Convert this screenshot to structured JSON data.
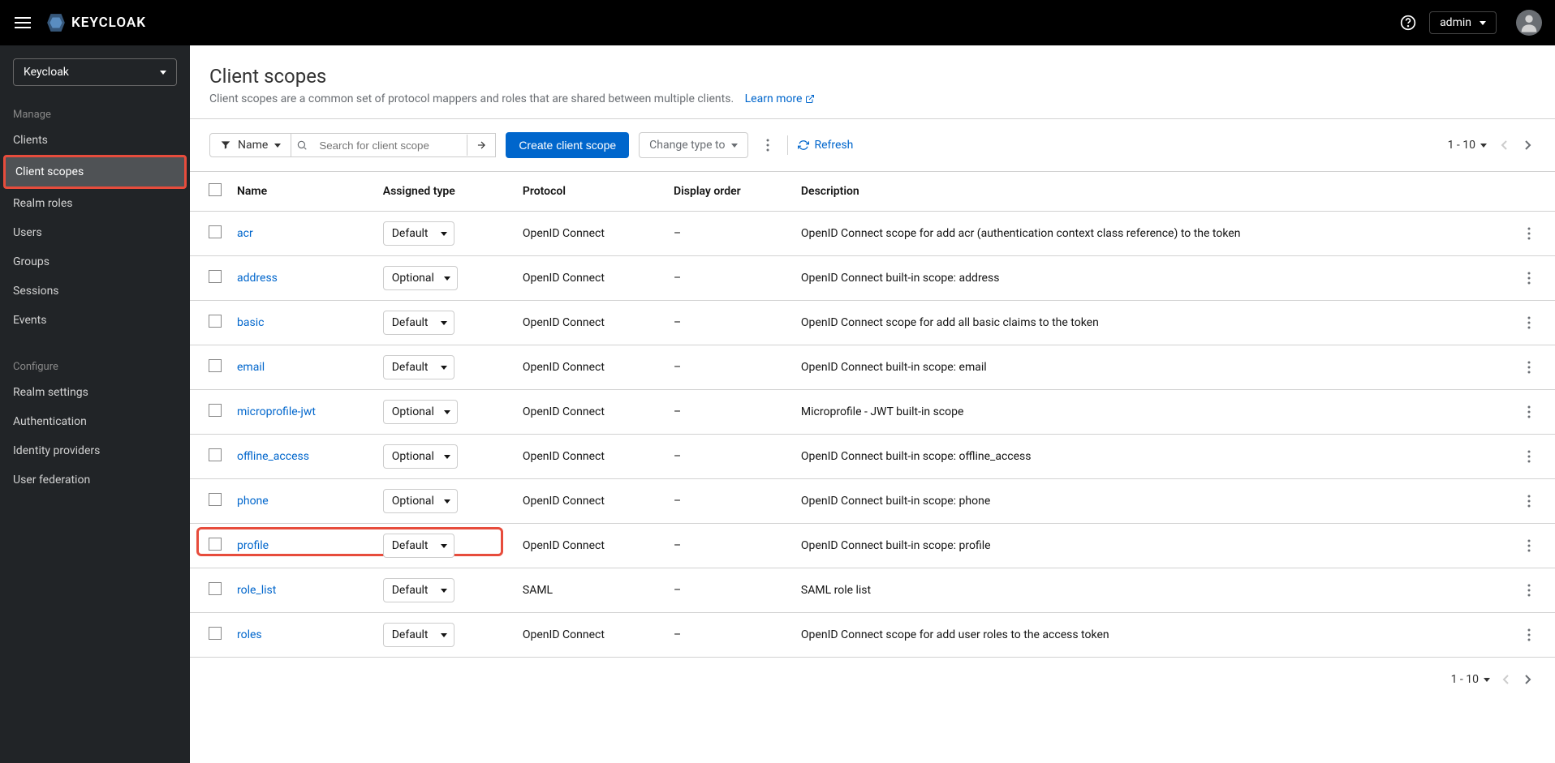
{
  "header": {
    "logo_text": "KEYCLOAK",
    "username": "admin"
  },
  "sidebar": {
    "realm_selected": "Keycloak",
    "section_manage": "Manage",
    "section_configure": "Configure",
    "items_manage": [
      {
        "label": "Clients"
      },
      {
        "label": "Client scopes"
      },
      {
        "label": "Realm roles"
      },
      {
        "label": "Users"
      },
      {
        "label": "Groups"
      },
      {
        "label": "Sessions"
      },
      {
        "label": "Events"
      }
    ],
    "items_configure": [
      {
        "label": "Realm settings"
      },
      {
        "label": "Authentication"
      },
      {
        "label": "Identity providers"
      },
      {
        "label": "User federation"
      }
    ]
  },
  "page": {
    "title": "Client scopes",
    "description": "Client scopes are a common set of protocol mappers and roles that are shared between multiple clients.",
    "learn_more": "Learn more"
  },
  "toolbar": {
    "filter_label": "Name",
    "search_placeholder": "Search for client scope",
    "create_button": "Create client scope",
    "change_type": "Change type to",
    "refresh": "Refresh",
    "page_info": "1 - 10"
  },
  "table": {
    "columns": {
      "name": "Name",
      "assigned_type": "Assigned type",
      "protocol": "Protocol",
      "display_order": "Display order",
      "description": "Description"
    },
    "rows": [
      {
        "name": "acr",
        "type": "Default",
        "protocol": "OpenID Connect",
        "order": "–",
        "description": "OpenID Connect scope for add acr (authentication context class reference) to the token"
      },
      {
        "name": "address",
        "type": "Optional",
        "protocol": "OpenID Connect",
        "order": "–",
        "description": "OpenID Connect built-in scope: address"
      },
      {
        "name": "basic",
        "type": "Default",
        "protocol": "OpenID Connect",
        "order": "–",
        "description": "OpenID Connect scope for add all basic claims to the token"
      },
      {
        "name": "email",
        "type": "Default",
        "protocol": "OpenID Connect",
        "order": "–",
        "description": "OpenID Connect built-in scope: email"
      },
      {
        "name": "microprofile-jwt",
        "type": "Optional",
        "protocol": "OpenID Connect",
        "order": "–",
        "description": "Microprofile - JWT built-in scope"
      },
      {
        "name": "offline_access",
        "type": "Optional",
        "protocol": "OpenID Connect",
        "order": "–",
        "description": "OpenID Connect built-in scope: offline_access"
      },
      {
        "name": "phone",
        "type": "Optional",
        "protocol": "OpenID Connect",
        "order": "–",
        "description": "OpenID Connect built-in scope: phone"
      },
      {
        "name": "profile",
        "type": "Default",
        "protocol": "OpenID Connect",
        "order": "–",
        "description": "OpenID Connect built-in scope: profile"
      },
      {
        "name": "role_list",
        "type": "Default",
        "protocol": "SAML",
        "order": "–",
        "description": "SAML role list"
      },
      {
        "name": "roles",
        "type": "Default",
        "protocol": "OpenID Connect",
        "order": "–",
        "description": "OpenID Connect scope for add user roles to the access token"
      }
    ]
  }
}
